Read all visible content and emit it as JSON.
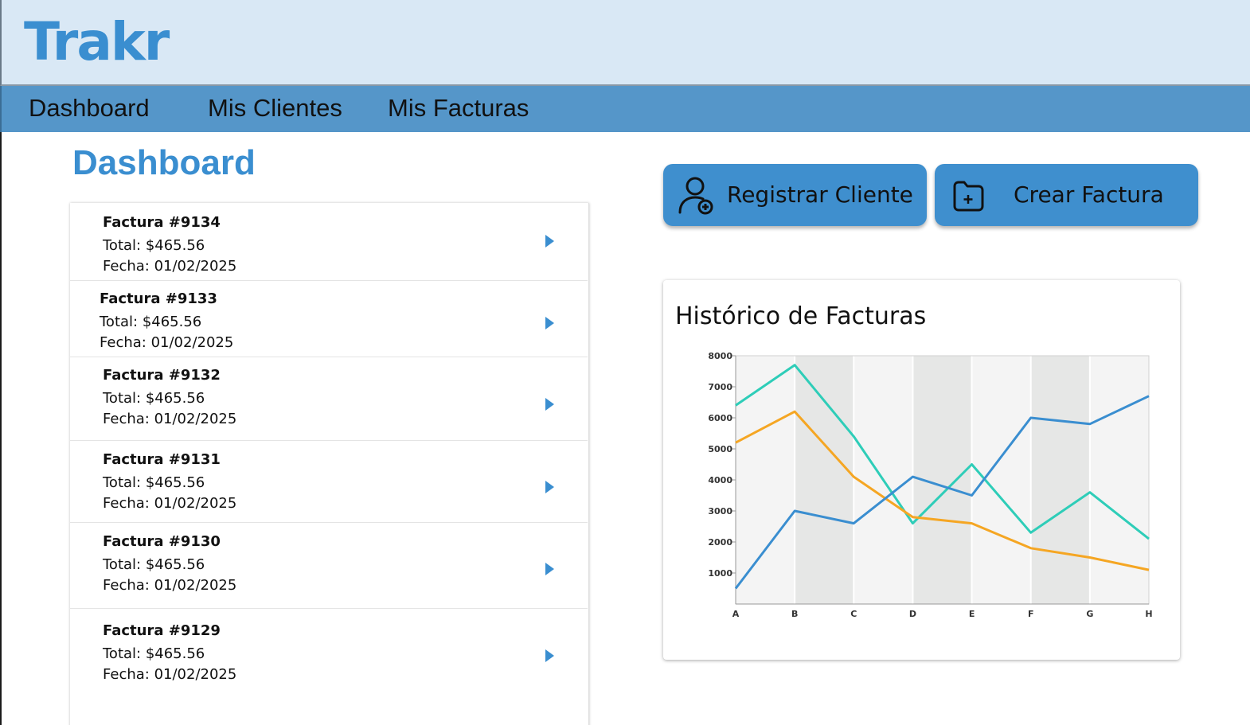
{
  "app": {
    "brand": "Trakr"
  },
  "nav": {
    "items": [
      {
        "label": "Dashboard"
      },
      {
        "label": "Mis Clientes"
      },
      {
        "label": "Mis Facturas"
      }
    ]
  },
  "page": {
    "title": "Dashboard"
  },
  "actions": {
    "register_client": "Registrar Cliente",
    "create_invoice": "Crear Factura"
  },
  "invoices": [
    {
      "title": "Factura #9134",
      "total": "Total: $465.56",
      "date": "Fecha: 01/02/2025"
    },
    {
      "title": "Factura #9133",
      "total": "Total: $465.56",
      "date": "Fecha: 01/02/2025"
    },
    {
      "title": "Factura #9132",
      "total": "Total: $465.56",
      "date": "Fecha: 01/02/2025"
    },
    {
      "title": "Factura #9131",
      "total": "Total: $465.56",
      "date": "Fecha: 01/02/2025"
    },
    {
      "title": "Factura #9130",
      "total": "Total: $465.56",
      "date": "Fecha: 01/02/2025"
    },
    {
      "title": "Factura #9129",
      "total": "Total: $465.56",
      "date": "Fecha: 01/02/2025"
    }
  ],
  "chart_data": {
    "type": "line",
    "title": "Histórico de Facturas",
    "categories": [
      "A",
      "B",
      "C",
      "D",
      "E",
      "F",
      "G",
      "H"
    ],
    "y_ticks": [
      1000,
      2000,
      3000,
      4000,
      5000,
      6000,
      7000,
      8000
    ],
    "ylim": [
      0,
      8000
    ],
    "grid": true,
    "series": [
      {
        "color": "#2ecdb8",
        "values": [
          6400,
          7700,
          5400,
          2600,
          4500,
          2300,
          3600,
          2100
        ]
      },
      {
        "color": "#f5a623",
        "values": [
          5200,
          6200,
          4100,
          2800,
          2600,
          1800,
          1500,
          1100
        ]
      },
      {
        "color": "#3a8ed0",
        "values": [
          500,
          3000,
          2600,
          4100,
          3500,
          6000,
          5800,
          6700
        ]
      }
    ]
  },
  "colors": {
    "accent": "#3a8ed0",
    "header_bg": "#d9e8f5",
    "nav_bg": "#5596c9"
  },
  "icons": {
    "register_client": "user-add-icon",
    "create_invoice": "folder-add-icon",
    "row_arrow": "caret-right-icon"
  }
}
